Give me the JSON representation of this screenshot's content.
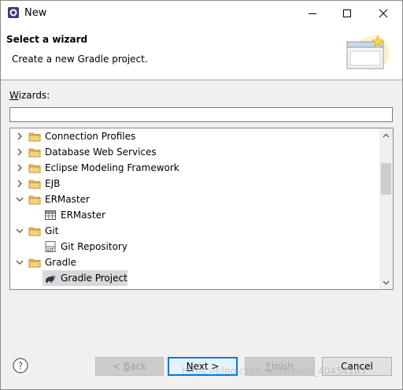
{
  "window": {
    "title": "New"
  },
  "header": {
    "title": "Select a wizard",
    "description": "Create a new Gradle project."
  },
  "wizards": {
    "label_prefix": "W",
    "label_rest": "izards:",
    "filter_value": ""
  },
  "tree": {
    "items": [
      {
        "label": "Connection Profiles",
        "icon": "folder-icon",
        "expanded": false,
        "level": 0
      },
      {
        "label": "Database Web Services",
        "icon": "folder-icon",
        "expanded": false,
        "level": 0
      },
      {
        "label": "Eclipse Modeling Framework",
        "icon": "folder-icon",
        "expanded": false,
        "level": 0
      },
      {
        "label": "EJB",
        "icon": "folder-icon",
        "expanded": false,
        "level": 0
      },
      {
        "label": "ERMaster",
        "icon": "folder-icon",
        "expanded": true,
        "level": 0
      },
      {
        "label": "ERMaster",
        "icon": "table-icon",
        "level": 1
      },
      {
        "label": "Git",
        "icon": "folder-icon",
        "expanded": true,
        "level": 0
      },
      {
        "label": "Git Repository",
        "icon": "git-icon",
        "level": 1
      },
      {
        "label": "Gradle",
        "icon": "folder-icon",
        "expanded": true,
        "level": 0
      },
      {
        "label": "Gradle Project",
        "icon": "gradle-icon",
        "level": 1,
        "selected": true
      }
    ]
  },
  "buttons": {
    "back_prefix": "< ",
    "back_mnemonic": "B",
    "back_rest": "ack",
    "next_mnemonic": "N",
    "next_rest": "ext >",
    "finish_mnemonic": "F",
    "finish_rest": "inish",
    "cancel": "Cancel"
  },
  "watermark": "https://blog.csdn.net/weixin_40454163",
  "colors": {
    "accent": "#0078d7",
    "folder": "#e8b94a",
    "selection": "#d9d9d9"
  }
}
